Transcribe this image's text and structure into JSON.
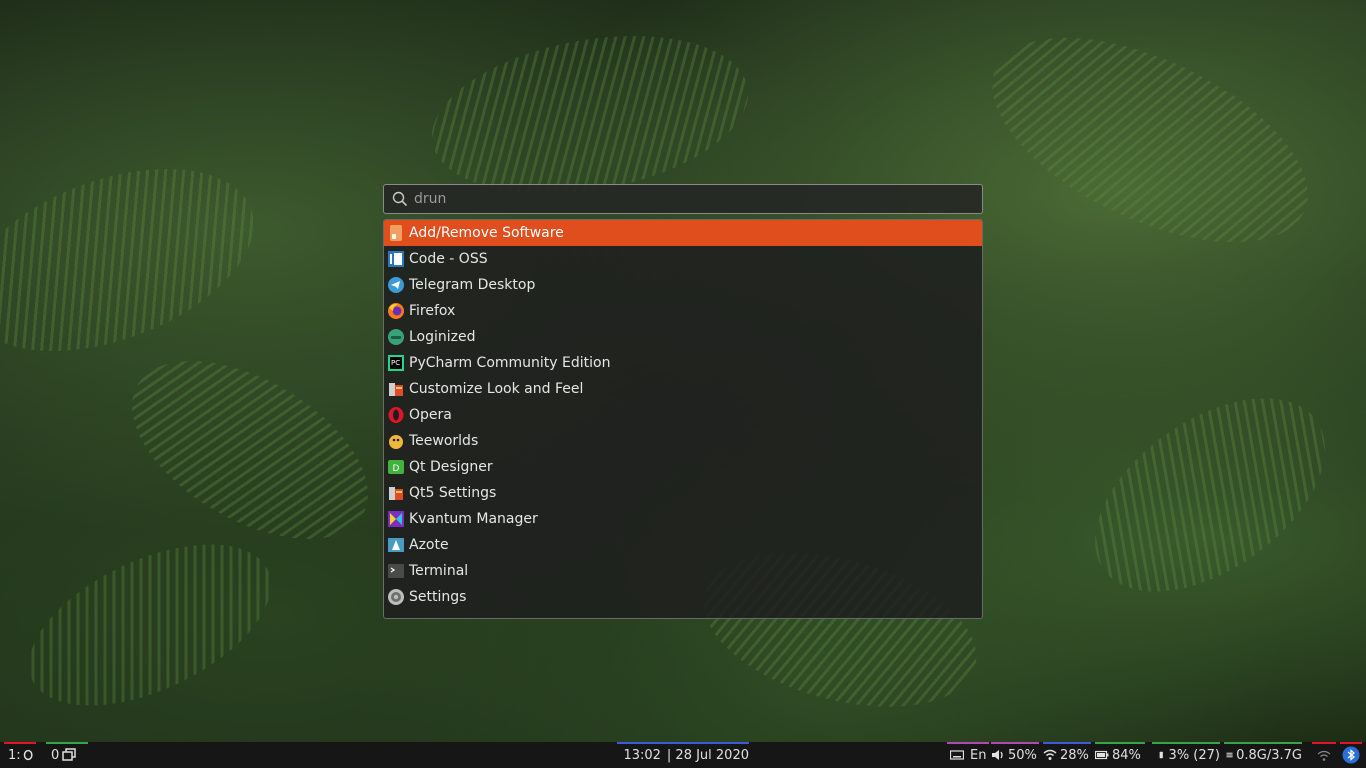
{
  "search": {
    "placeholder": "drun",
    "value": ""
  },
  "apps": [
    {
      "label": "Add/Remove Software",
      "icon": "package-icon",
      "selected": true
    },
    {
      "label": "Code - OSS",
      "icon": "code-oss-icon",
      "selected": false
    },
    {
      "label": "Telegram Desktop",
      "icon": "telegram-icon",
      "selected": false
    },
    {
      "label": "Firefox",
      "icon": "firefox-icon",
      "selected": false
    },
    {
      "label": "Loginized",
      "icon": "loginized-icon",
      "selected": false
    },
    {
      "label": "PyCharm Community Edition",
      "icon": "pycharm-icon",
      "selected": false
    },
    {
      "label": "Customize Look and Feel",
      "icon": "customize-icon",
      "selected": false
    },
    {
      "label": "Opera",
      "icon": "opera-icon",
      "selected": false
    },
    {
      "label": "Teeworlds",
      "icon": "teeworlds-icon",
      "selected": false
    },
    {
      "label": "Qt Designer",
      "icon": "qt-designer-icon",
      "selected": false
    },
    {
      "label": "Qt5 Settings",
      "icon": "qt5-settings-icon",
      "selected": false
    },
    {
      "label": "Kvantum Manager",
      "icon": "kvantum-icon",
      "selected": false
    },
    {
      "label": "Azote",
      "icon": "azote-icon",
      "selected": false
    },
    {
      "label": "Terminal",
      "icon": "terminal-icon",
      "selected": false
    },
    {
      "label": "Settings",
      "icon": "settings-icon",
      "selected": false
    }
  ],
  "colors": {
    "accent": "#e14e1d",
    "panel": "#1e1e1e"
  },
  "taskbar": {
    "workspace_1": "1:",
    "workspace_2": "0",
    "time": "13:02",
    "date": "| 28 Jul 2020",
    "keyboard_layout": "En",
    "volume": "50%",
    "wifi": "28%",
    "battery": "84%",
    "cpu": "3% (27)",
    "memory": "0.8G/3.7G"
  }
}
